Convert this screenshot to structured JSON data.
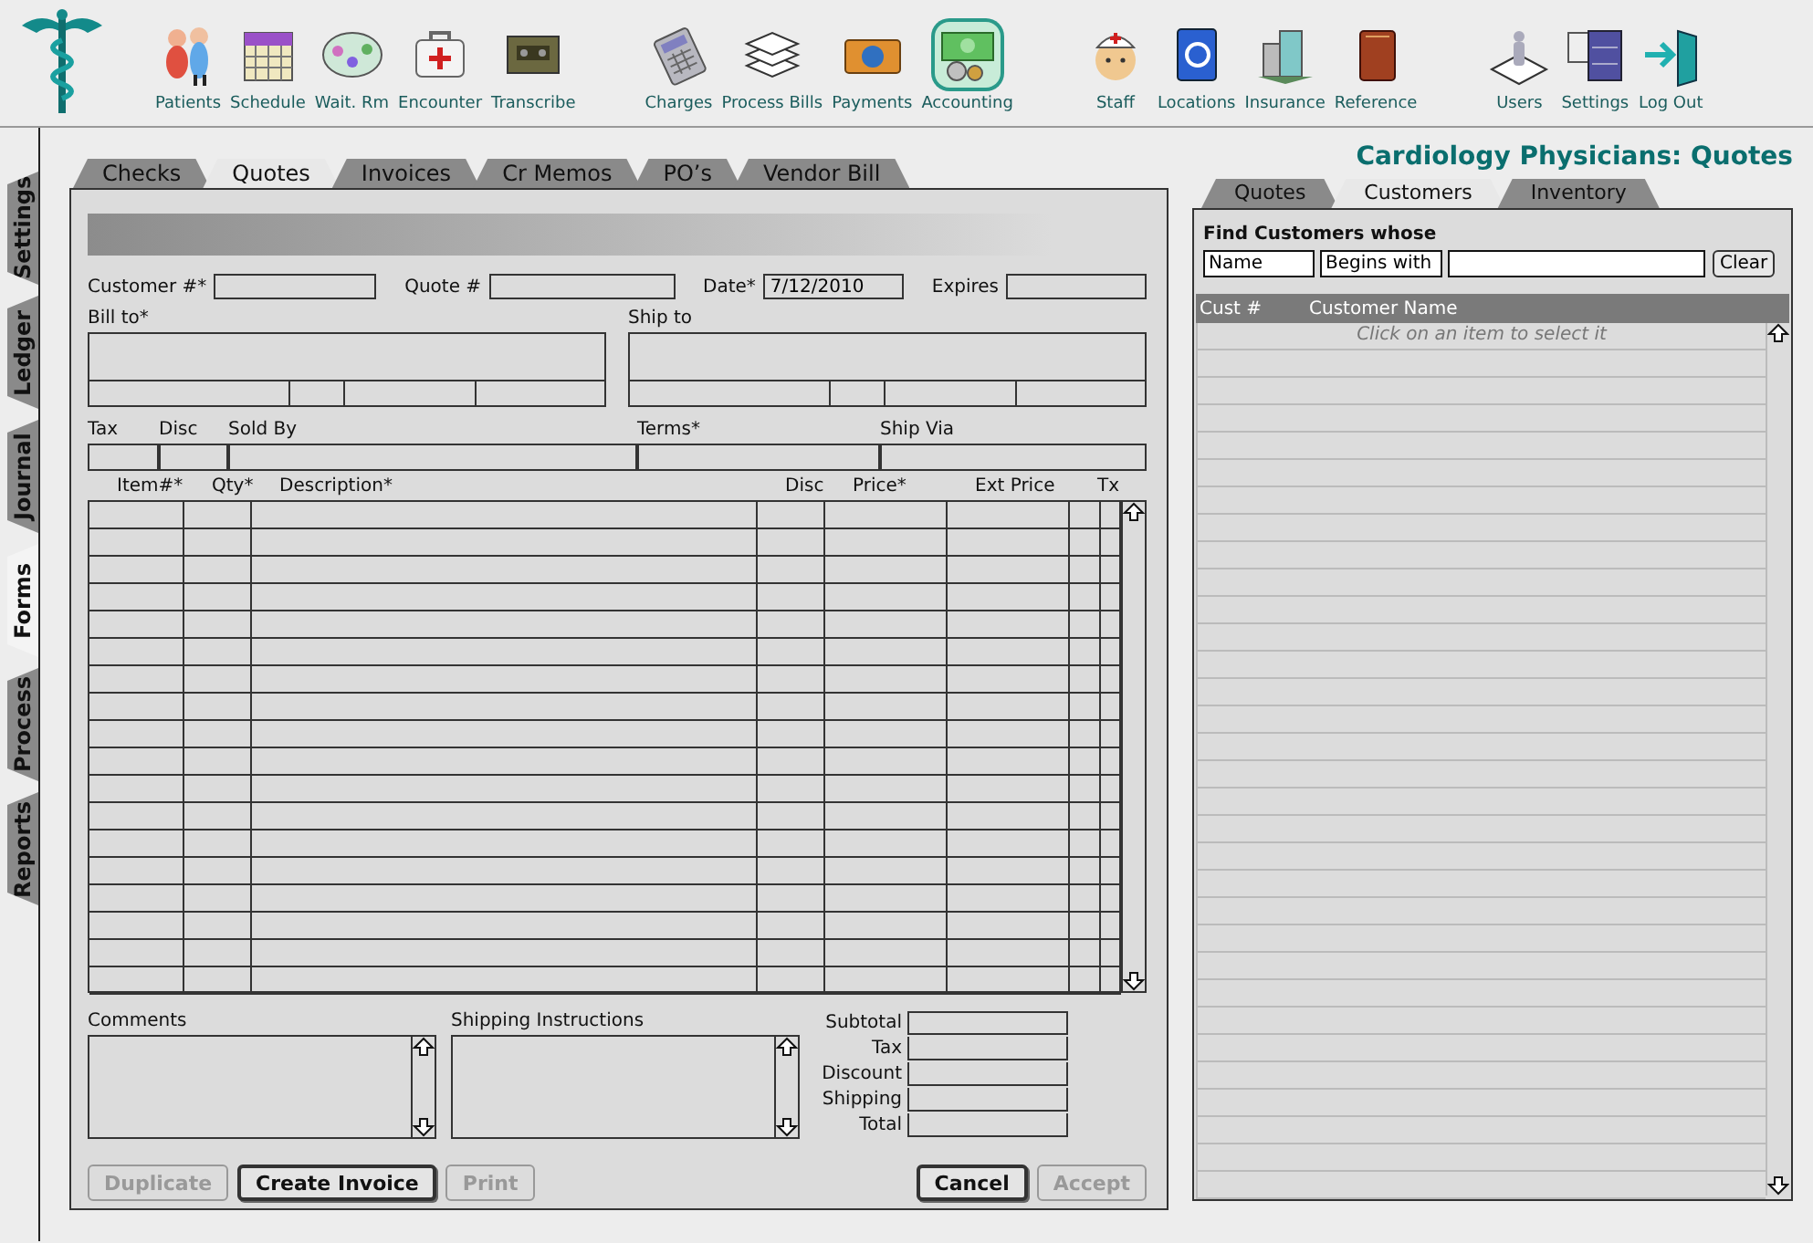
{
  "toolbar": {
    "groups": [
      [
        {
          "label": "Patients",
          "selected": false
        },
        {
          "label": "Schedule",
          "selected": false
        },
        {
          "label": "Wait. Rm",
          "selected": false
        },
        {
          "label": "Encounter",
          "selected": false
        },
        {
          "label": "Transcribe",
          "selected": false
        }
      ],
      [
        {
          "label": "Charges",
          "selected": false
        },
        {
          "label": "Process Bills",
          "selected": false
        },
        {
          "label": "Payments",
          "selected": false
        },
        {
          "label": "Accounting",
          "selected": true
        }
      ],
      [
        {
          "label": "Staff",
          "selected": false
        },
        {
          "label": "Locations",
          "selected": false
        },
        {
          "label": "Insurance",
          "selected": false
        },
        {
          "label": "Reference",
          "selected": false
        }
      ],
      [
        {
          "label": "Users",
          "selected": false
        },
        {
          "label": "Settings",
          "selected": false
        },
        {
          "label": "Log Out",
          "selected": false
        }
      ]
    ]
  },
  "side_tabs": [
    {
      "label": "Settings",
      "selected": false
    },
    {
      "label": "Ledger",
      "selected": false
    },
    {
      "label": "Journal",
      "selected": false
    },
    {
      "label": "Forms",
      "selected": true
    },
    {
      "label": "Process",
      "selected": false
    },
    {
      "label": "Reports",
      "selected": false
    }
  ],
  "form_tabs": [
    {
      "label": "Checks",
      "selected": false
    },
    {
      "label": "Quotes",
      "selected": true
    },
    {
      "label": "Invoices",
      "selected": false
    },
    {
      "label": "Cr Memos",
      "selected": false
    },
    {
      "label": "PO’s",
      "selected": false
    },
    {
      "label": "Vendor Bill",
      "selected": false
    }
  ],
  "form": {
    "header_fields": [
      {
        "label": "Customer #*"
      },
      {
        "label": "Quote #"
      },
      {
        "label": "Date*",
        "value": "7/12/2010"
      },
      {
        "label": "Expires"
      }
    ],
    "bill_to": {
      "label": "Bill to*"
    },
    "ship_to": {
      "label": "Ship to"
    },
    "detail_fields": [
      {
        "label": "Tax"
      },
      {
        "label": "Disc"
      },
      {
        "label": "Sold By"
      },
      {
        "label": "Terms*"
      },
      {
        "label": "Ship Via"
      }
    ],
    "line_items": {
      "columns": [
        "Item#*",
        "Qty*",
        "Description*",
        "Disc",
        "Price*",
        "Ext Price",
        "Tx"
      ]
    },
    "comments": {
      "label": "Comments"
    },
    "shipping_instructions": {
      "label": "Shipping Instructions"
    },
    "totals": [
      "Subtotal",
      "Tax",
      "Discount",
      "Shipping",
      "Total"
    ],
    "buttons_left": [
      {
        "label": "Duplicate",
        "disabled": true,
        "default": false
      },
      {
        "label": "Create Invoice",
        "disabled": false,
        "default": true
      },
      {
        "label": "Print",
        "disabled": true,
        "default": false
      }
    ],
    "buttons_right": [
      {
        "label": "Cancel",
        "disabled": false,
        "default": true
      },
      {
        "label": "Accept",
        "disabled": true,
        "default": false
      }
    ]
  },
  "page_title": "Cardiology Physicians:  Quotes",
  "panel_tabs": [
    {
      "label": "Quotes",
      "selected": false
    },
    {
      "label": "Customers",
      "selected": true
    },
    {
      "label": "Inventory",
      "selected": false
    }
  ],
  "find": {
    "title": "Find Customers whose",
    "field": "Name",
    "operator": "Begins with",
    "button": "Clear"
  },
  "customer_list": {
    "columns": [
      "Cust #",
      "Customer Name"
    ],
    "hint": "Click on an item to select it"
  }
}
